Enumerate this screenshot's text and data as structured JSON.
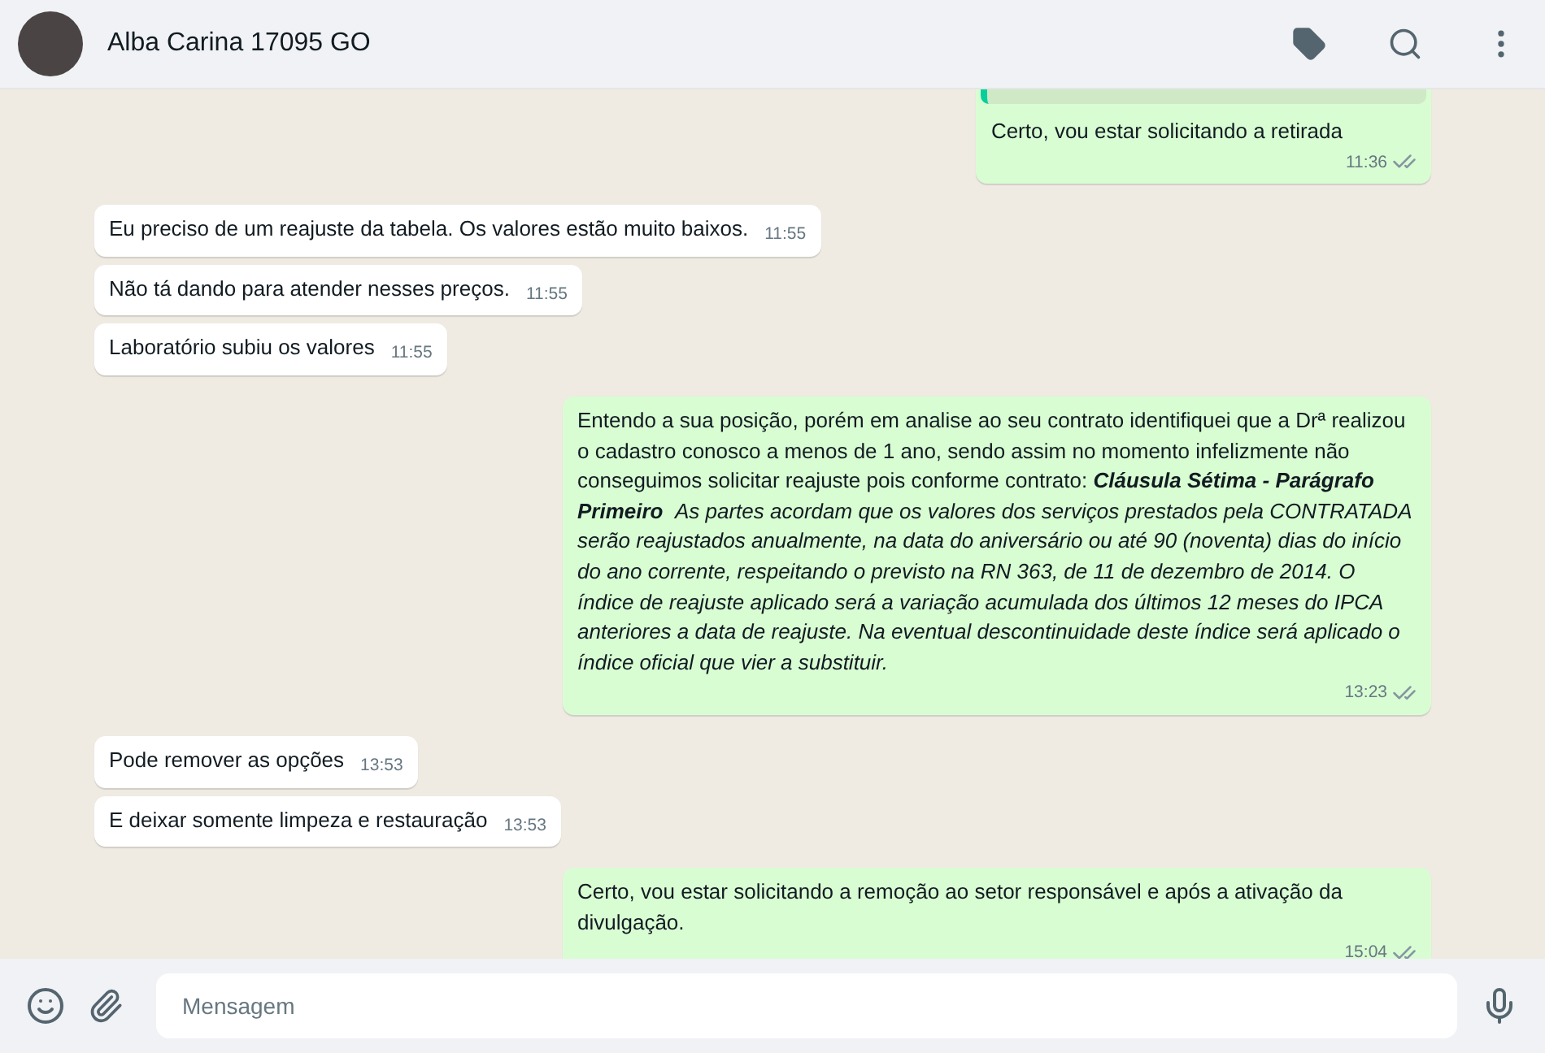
{
  "header": {
    "title": "Alba Carina 17095 GO"
  },
  "messages": [
    {
      "kind": "sent",
      "has_quote": true,
      "text": "Certo, vou estar solicitando a retirada",
      "time": "11:36",
      "read": false
    },
    {
      "kind": "received",
      "text": "Eu preciso de um reajuste da tabela. Os valores estão muito baixos.",
      "time": "11:55"
    },
    {
      "kind": "received",
      "text": "Não tá dando para atender nesses preços.",
      "time": "11:55"
    },
    {
      "kind": "received",
      "text": "Laboratório subiu os valores",
      "time": "11:55"
    },
    {
      "kind": "sent",
      "text": "Entendo a sua posição, porém em analise ao seu contrato identifiquei que a Drª realizou o cadastro conosco a menos de 1 ano, sendo assim no momento infelizmente não conseguimos solicitar reajuste pois conforme contrato: **Cláusula Sétima - Parágrafo Primeiro**  *As partes acordam que os valores dos serviços prestados pela CONTRATADA serão reajustados anualmente, na data do aniversário ou até 90 (noventa) dias do início do ano corrente, respeitando o previsto na RN 363, de 11 de dezembro de 2014. O índice de reajuste aplicado será a variação acumulada dos últimos 12 meses do IPCA anteriores a data de reajuste. Na eventual descontinuidade deste índice será aplicado o índice oficial que vier a substituir.*",
      "time": "13:23",
      "read": false
    },
    {
      "kind": "received",
      "text": "Pode remover as opções",
      "time": "13:53"
    },
    {
      "kind": "received",
      "text": "E deixar somente limpeza e restauração",
      "time": "13:53"
    },
    {
      "kind": "sent",
      "text": "Certo, vou estar solicitando a remoção ao setor responsável e após a ativação da divulgação.",
      "time": "15:04",
      "read": false
    }
  ],
  "composer": {
    "placeholder": "Mensagem"
  }
}
